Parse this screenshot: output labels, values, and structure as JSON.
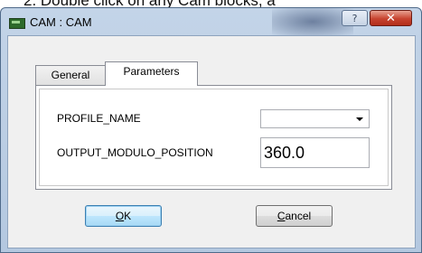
{
  "background": {
    "text": "2. Double click on any Cam blocks, a"
  },
  "window": {
    "title": "CAM : CAM",
    "help_symbol": "?",
    "close_symbol": "✕"
  },
  "tabs": [
    {
      "label": "General",
      "selected": false
    },
    {
      "label": "Parameters",
      "selected": true
    }
  ],
  "parameters": {
    "profile_name": {
      "label": "PROFILE_NAME",
      "value": ""
    },
    "output_modulo_position": {
      "label": "OUTPUT_MODULO_POSITION",
      "value": "360.0"
    }
  },
  "buttons": {
    "ok": {
      "mnemonic": "O",
      "rest": "K"
    },
    "cancel": {
      "mnemonic": "C",
      "rest": "ancel"
    }
  }
}
